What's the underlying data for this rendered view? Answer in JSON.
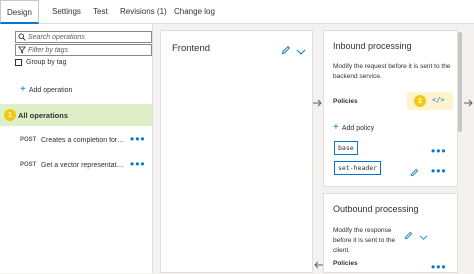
{
  "tabs": [
    {
      "label": "Design"
    },
    {
      "label": "Settings"
    },
    {
      "label": "Test"
    },
    {
      "label": "Revisions (1)"
    },
    {
      "label": "Change log"
    }
  ],
  "sidebar": {
    "search_operations_placeholder": "Search operations",
    "filter_tags_placeholder": "Filter by tags",
    "group_by_tag_label": "Group by tag",
    "add_operation_label": "Add operation",
    "all_operations_label": "All operations",
    "all_operations_step": "1",
    "operations": [
      {
        "verb": "POST",
        "name": "Creates a completion for t..."
      },
      {
        "verb": "POST",
        "name": "Get a vector representation..."
      }
    ]
  },
  "frontend": {
    "title": "Frontend"
  },
  "inbound": {
    "title": "Inbound processing",
    "description": "Modify the request before it is sent to the backend service.",
    "policies_label": "Policies",
    "code_view_step": "2",
    "code_view_label": "</>",
    "add_policy_label": "Add policy",
    "policy_tags": [
      "base",
      "set-header"
    ]
  },
  "outbound": {
    "title": "Outbound processing",
    "description": "Modify the response before it is sent to the client.",
    "policies_label": "Policies"
  },
  "colors": {
    "accent": "#0078d4",
    "highlight_row": "#dff0c8",
    "step_badge": "#f2c811",
    "code_highlight": "#fff4ce"
  }
}
